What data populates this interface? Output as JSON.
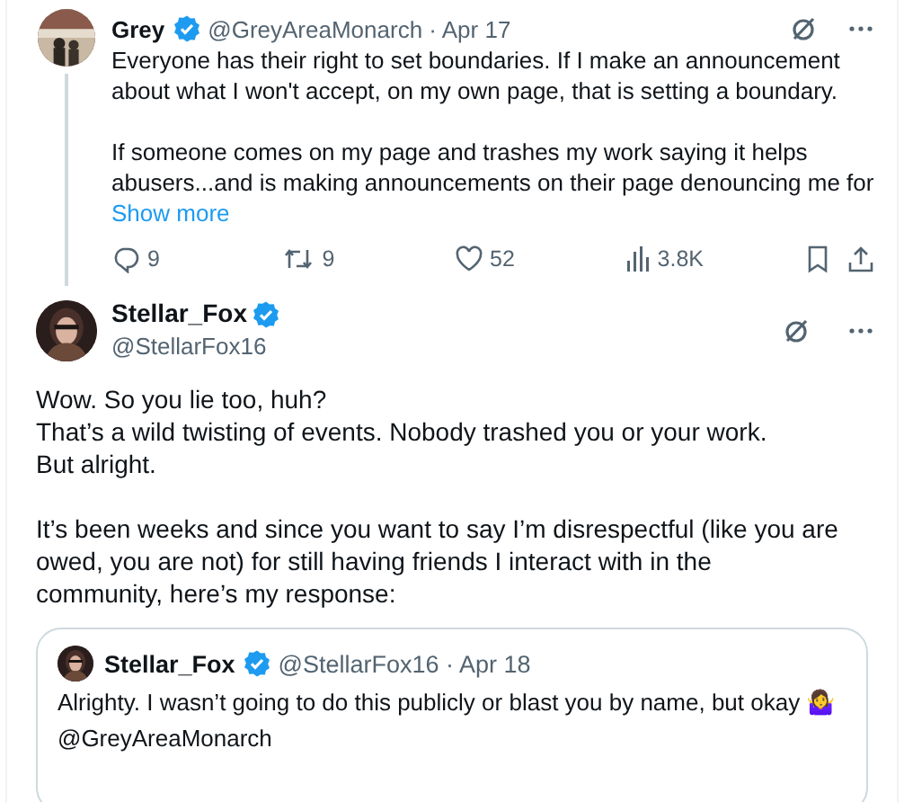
{
  "posts": [
    {
      "kind": "reply_parent",
      "name": "Grey",
      "verified": true,
      "meta": "@GreyAreaMonarch · Apr 17",
      "thread_line": true,
      "paragraphs": [
        "Everyone has their right to set boundaries. If I make an announcement\nabout what I won't accept, on my own page, that is setting a boundary.",
        "If someone comes on my page and trashes my work saying it helps\nabusers...and is making announcements on their page denouncing me for"
      ],
      "show_more": "Show more",
      "actions": [
        {
          "kind": "reply",
          "count": "9"
        },
        {
          "kind": "repost",
          "count": "9"
        },
        {
          "kind": "like",
          "count": "52"
        },
        {
          "kind": "views",
          "count": "3.8K"
        },
        {
          "kind": "bookmark"
        },
        {
          "kind": "share"
        }
      ]
    },
    {
      "kind": "focused",
      "name": "Stellar_Fox",
      "verified": true,
      "meta": "@StellarFox16",
      "paragraphs": [
        "Wow. So you lie too, huh?\nThat’s a wild twisting of events. Nobody trashed you or your work.\nBut alright.",
        "It’s been weeks and since you want to say I’m disrespectful (like you are\nowed, you are not) for still having friends I interact with in the\ncommunity, here’s my response:"
      ],
      "quote": {
        "name": "Stellar_Fox",
        "verified": true,
        "meta": "@StellarFox16 · Apr 18",
        "text": "Alrighty. I wasn’t going to do this publicly or blast you by name, but okay 🤷‍♀️\n@GreyAreaMonarch"
      }
    }
  ]
}
